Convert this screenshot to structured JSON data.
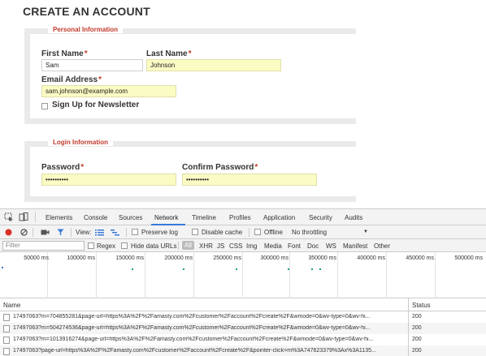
{
  "page": {
    "title": "CREATE AN ACCOUNT"
  },
  "personal": {
    "legend": "Personal Information",
    "first_name_label": "First Name",
    "first_name_value": "Sam",
    "last_name_label": "Last Name",
    "last_name_value": "Johnson",
    "email_label": "Email Address",
    "email_value": "sam.johnson@example.com",
    "newsletter_label": "Sign Up for Newsletter",
    "required_mark": "*"
  },
  "login": {
    "legend": "Login Information",
    "password_label": "Password",
    "password_value": "••••••••••",
    "confirm_label": "Confirm Password",
    "confirm_value": "••••••••••",
    "required_mark": "*"
  },
  "devtools": {
    "tabs": [
      "Elements",
      "Console",
      "Sources",
      "Network",
      "Timeline",
      "Profiles",
      "Application",
      "Security",
      "Audits"
    ],
    "active_tab": "Network",
    "toolbar": {
      "view_label": "View:",
      "preserve_log": "Preserve log",
      "disable_cache": "Disable cache",
      "offline": "Offline",
      "throttling": "No throttling",
      "throttle_arrow": "▼"
    },
    "filter": {
      "placeholder": "Filter",
      "regex": "Regex",
      "hide_data_urls": "Hide data URLs",
      "types": [
        "All",
        "XHR",
        "JS",
        "CSS",
        "Img",
        "Media",
        "Font",
        "Doc",
        "WS",
        "Manifest",
        "Other"
      ]
    },
    "timeline_ticks": [
      "50000 ms",
      "100000 ms",
      "150000 ms",
      "200000 ms",
      "250000 ms",
      "300000 ms",
      "350000 ms",
      "400000 ms",
      "450000 ms",
      "500000 ms"
    ],
    "table": {
      "name_header": "Name",
      "status_header": "Status",
      "rows": [
        {
          "name": "17497063?m=704855281&page-url=https%3A%2F%2Famasty.com%2Fcustomer%2Faccount%2Fcreate%2F&wmode=0&wv-type=0&wv-hi...",
          "status": "200"
        },
        {
          "name": "17497063?m=504274536&page-url=https%3A%2F%2Famasty.com%2Fcustomer%2Faccount%2Fcreate%2F&wmode=0&wv-type=0&wv-hi...",
          "status": "200"
        },
        {
          "name": "17497063?m=1013916274&page-url=https%3A%2F%2Famasty.com%2Fcustomer%2Faccount%2Fcreate%2F&wmode=0&wv-type=0&wv-hi...",
          "status": "200"
        },
        {
          "name": "17497063?page-url=https%3A%2F%2Famasty.com%2Fcustomer%2Faccount%2Fcreate%2F&pointer-click=m%3A747623379%3Ax%3A1135...",
          "status": "200"
        }
      ]
    },
    "colors": {
      "record": "#d93025",
      "accent": "#3879d9",
      "required": "#c0392b",
      "autofill": "#fbfbc4"
    }
  }
}
